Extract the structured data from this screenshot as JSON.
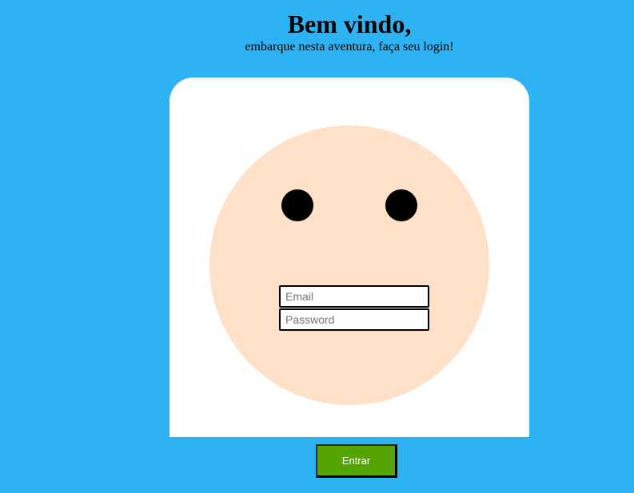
{
  "header": {
    "title": "Bem vindo,",
    "subtitle": "embarque nesta aventura, faça seu login!"
  },
  "login_form": {
    "email_placeholder": "Email",
    "email_value": "",
    "password_placeholder": "Password",
    "password_value": "",
    "submit_label": "Entrar"
  },
  "colors": {
    "page_background": "#2db3f4",
    "card_background": "#ffffff",
    "face": "#ffe1c9",
    "eyes": "#000000",
    "button": "#54a500",
    "button_text": "#ffffff"
  }
}
